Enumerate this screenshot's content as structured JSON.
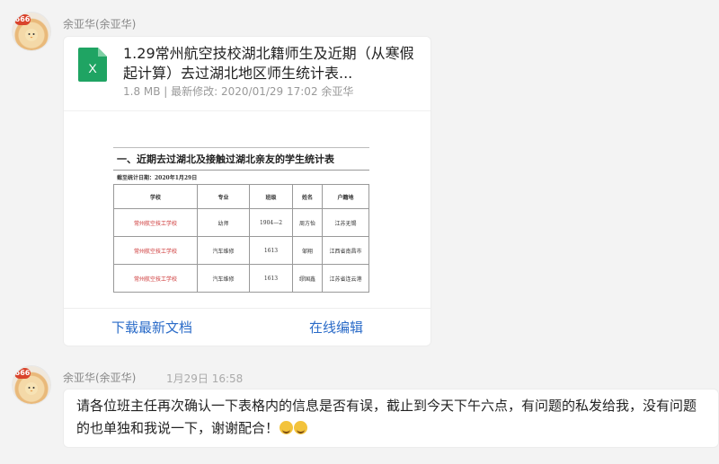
{
  "messages": [
    {
      "sender": "余亚华(余亚华)",
      "badge": "666",
      "file": {
        "title": "1.29常州航空技校湖北籍师生及近期（从寒假起计算）去过湖北地区师生统计表...",
        "meta": "1.8 MB | 最新修改: 2020/01/29 17:02 余亚华",
        "icon": "excel-file-icon",
        "preview": {
          "heading": "一、近期去过湖北及接触过湖北亲友的学生统计表",
          "date_line": "截至统计日期：2020年1月29日",
          "columns": [
            "学校",
            "专业",
            "班级",
            "姓名",
            "户籍地"
          ],
          "rows": [
            [
              "常州航空技工学校",
              "幼师",
              "1904—2",
              "周方怡",
              "江苏无锡"
            ],
            [
              "常州航空技工学校",
              "汽车维修",
              "1613",
              "邹翔",
              "江西省南昌市"
            ],
            [
              "常州航空技工学校",
              "汽车维修",
              "1613",
              "缪国鑫",
              "江苏省连云港"
            ]
          ]
        },
        "actions": {
          "download": "下载最新文档",
          "edit": "在线编辑"
        }
      }
    },
    {
      "sender": "余亚华(余亚华)",
      "badge": "666",
      "time": "1月29日 16:58",
      "text": "请各位班主任再次确认一下表格内的信息是否有误，截止到今天下午六点，有问题的私发给我，没有问题的也单独和我说一下，谢谢配合！",
      "emojis": [
        "grin-emoji",
        "grin-emoji"
      ]
    }
  ],
  "colors": {
    "link": "#2a6bc8",
    "excel_green": "#1fa463",
    "school_red": "#cc3333"
  }
}
